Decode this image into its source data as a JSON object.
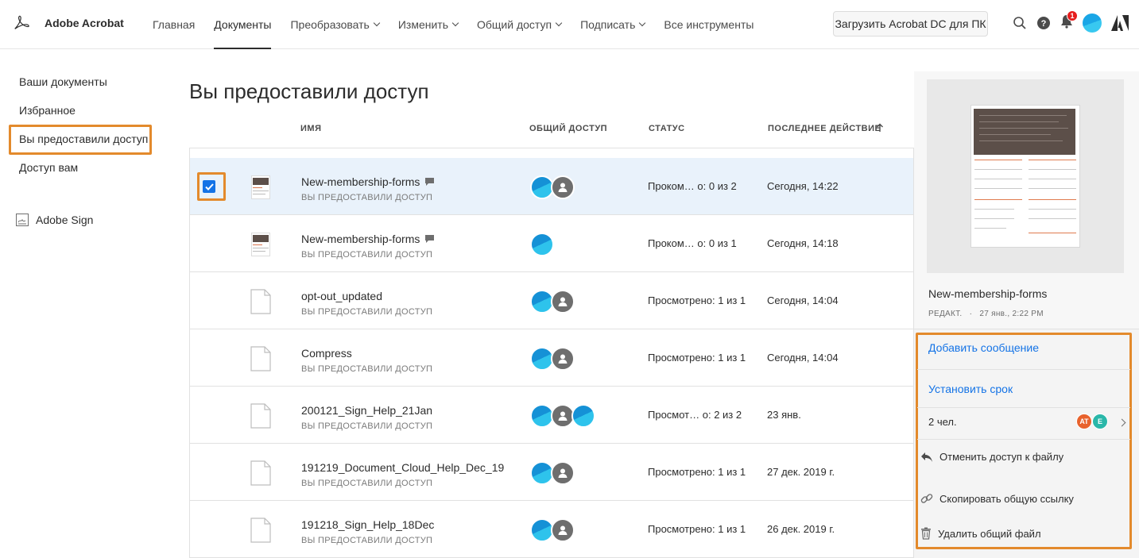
{
  "header": {
    "app_name": "Adobe Acrobat",
    "nav": [
      {
        "label": "Главная",
        "dropdown": false,
        "active": false
      },
      {
        "label": "Документы",
        "dropdown": false,
        "active": true
      },
      {
        "label": "Преобразовать",
        "dropdown": true,
        "active": false
      },
      {
        "label": "Изменить",
        "dropdown": true,
        "active": false
      },
      {
        "label": "Общий доступ",
        "dropdown": true,
        "active": false
      },
      {
        "label": "Подписать",
        "dropdown": true,
        "active": false
      },
      {
        "label": "Все инструменты",
        "dropdown": false,
        "active": false
      }
    ],
    "download_button": "Загрузить Acrobat DC для ПК",
    "notification_count": "1",
    "icons": [
      "search-icon",
      "help-icon",
      "bell-icon",
      "profile-avatar",
      "adobe-logo"
    ]
  },
  "sidebar": {
    "items": [
      "Ваши документы",
      "Избранное",
      "Вы предоставили доступ",
      "Доступ вам"
    ],
    "active_index": 2,
    "sign_label": "Adobe Sign"
  },
  "main": {
    "title": "Вы предоставили доступ",
    "columns": {
      "name": "ИМЯ",
      "sharing": "ОБЩИЙ ДОСТУП",
      "status": "СТАТУС",
      "last_action": "ПОСЛЕДНЕЕ ДЕЙСТВИЕ"
    },
    "rows": [
      {
        "name": "New-membership-forms",
        "sub": "ВЫ ПРЕДОСТАВИЛИ ДОСТУП",
        "status": "Проком… о: 0 из 2",
        "last": "Сегодня, 14:22",
        "selected": true,
        "thumb": "form",
        "comment": true,
        "avatars": [
          "blue",
          "gray"
        ]
      },
      {
        "name": "New-membership-forms",
        "sub": "ВЫ ПРЕДОСТАВИЛИ ДОСТУП",
        "status": "Проком… о: 0 из 1",
        "last": "Сегодня, 14:18",
        "selected": false,
        "thumb": "form",
        "comment": true,
        "avatars": [
          "blue"
        ]
      },
      {
        "name": "opt-out_updated",
        "sub": "ВЫ ПРЕДОСТАВИЛИ ДОСТУП",
        "status": "Просмотрено: 1 из 1",
        "last": "Сегодня, 14:04",
        "selected": false,
        "thumb": "file",
        "comment": false,
        "avatars": [
          "blue",
          "gray"
        ]
      },
      {
        "name": "Compress",
        "sub": "ВЫ ПРЕДОСТАВИЛИ ДОСТУП",
        "status": "Просмотрено: 1 из 1",
        "last": "Сегодня, 14:04",
        "selected": false,
        "thumb": "file",
        "comment": false,
        "avatars": [
          "blue",
          "gray"
        ]
      },
      {
        "name": "200121_Sign_Help_21Jan",
        "sub": "ВЫ ПРЕДОСТАВИЛИ ДОСТУП",
        "status": "Просмот… о: 2 из 2",
        "last": "23 янв.",
        "selected": false,
        "thumb": "file",
        "comment": false,
        "avatars": [
          "blue",
          "gray",
          "blue"
        ]
      },
      {
        "name": "191219_Document_Cloud_Help_Dec_19",
        "sub": "ВЫ ПРЕДОСТАВИЛИ ДОСТУП",
        "status": "Просмотрено: 1 из 1",
        "last": "27 дек. 2019 г.",
        "selected": false,
        "thumb": "file",
        "comment": false,
        "avatars": [
          "blue",
          "gray"
        ]
      },
      {
        "name": "191218_Sign_Help_18Dec",
        "sub": "ВЫ ПРЕДОСТАВИЛИ ДОСТУП",
        "status": "Просмотрено: 1 из 1",
        "last": "26 дек. 2019 г.",
        "selected": false,
        "thumb": "file",
        "comment": false,
        "avatars": [
          "blue",
          "gray"
        ]
      }
    ]
  },
  "right_panel": {
    "file_name": "New-membership-forms",
    "meta_label": "РЕДАКТ.",
    "meta_date": "27 янв., 2:22 PM",
    "add_message": "Добавить сообщение",
    "set_deadline": "Установить срок",
    "people_count": "2 чел.",
    "people_avatars": [
      {
        "initials": "AT",
        "color": "#e8622c"
      },
      {
        "initials": "E",
        "color": "#2ab7a9"
      }
    ],
    "unshare": "Отменить доступ к файлу",
    "copy_link": "Скопировать общую ссылку",
    "delete_shared": "Удалить общий файл"
  },
  "colors": {
    "accent": "#1473e6",
    "highlight": "#e38a2c",
    "selected_row": "#e9f2fb"
  }
}
